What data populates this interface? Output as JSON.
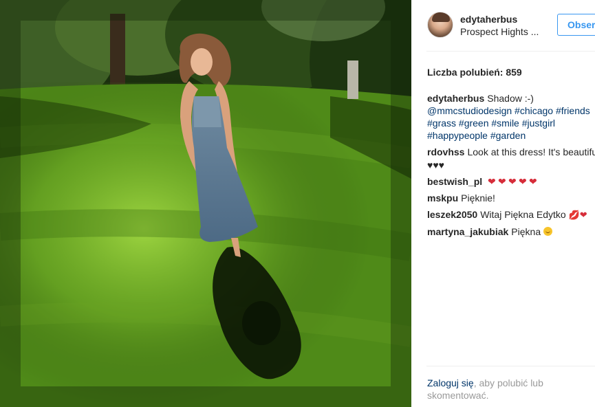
{
  "post": {
    "username": "edytaherbus",
    "location": "Prospect Hights ...",
    "follow_label": "Obser",
    "likes_text": "Liczba polubień: 859",
    "caption": {
      "user": "edytaherbus",
      "line1_text": "Shadow :-)",
      "line2": "@mmcstudiodesign #chicago #friends",
      "line3": "#grass #green #smile #justgirl",
      "line4": "#happypeople #garden"
    },
    "comments": [
      {
        "user": "rdovhss",
        "text": "Look at this dress! It's beautiful",
        "extra": "♥♥♥"
      },
      {
        "user": "bestwish_pl",
        "text": "",
        "emoji": "red-hearts-x5"
      },
      {
        "user": "mskpu",
        "text": "Pięknie!"
      },
      {
        "user": "leszek2050",
        "text": "Witaj Piękna Edytko",
        "emoji": "kiss-heart"
      },
      {
        "user": "martyna_jakubiak",
        "text": "Piękna",
        "emoji": "smile"
      }
    ],
    "login": {
      "link_text": "Zaloguj się",
      "rest_text": ", aby polubić lub",
      "line2": "skomentować."
    }
  },
  "icons": {
    "more": "more-options-icon",
    "avatar": "profile-avatar"
  },
  "colors": {
    "accent_blue": "#3897f0",
    "hashtag": "#003569",
    "muted": "#999999",
    "text": "#262626"
  }
}
